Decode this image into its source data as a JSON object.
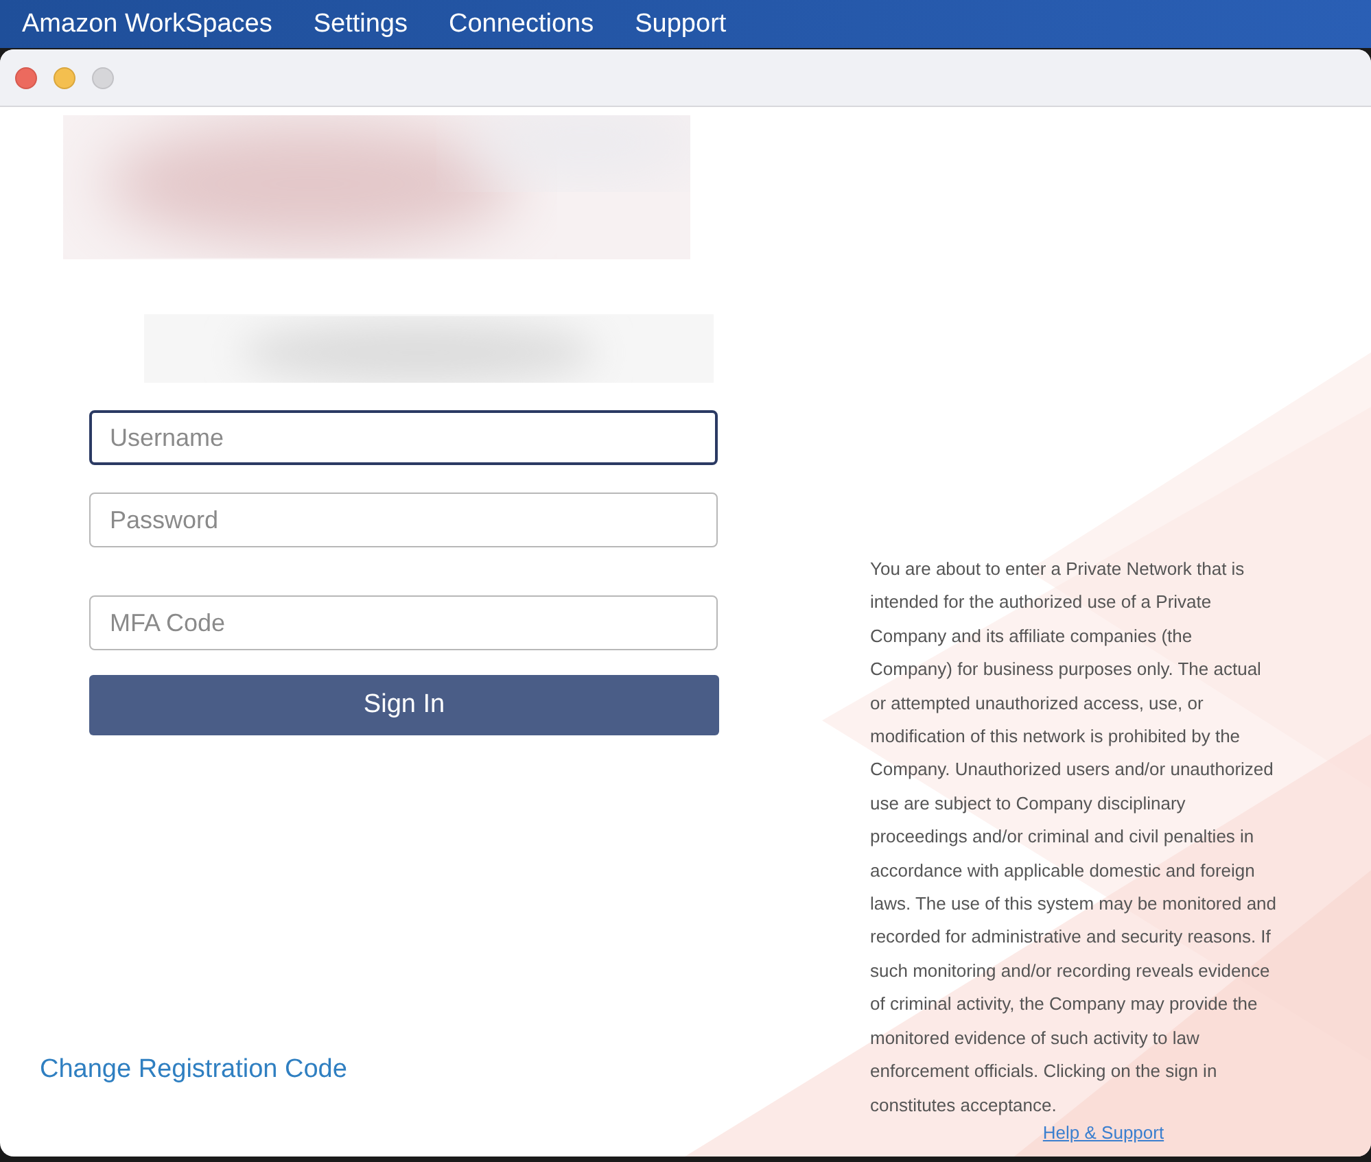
{
  "menu_bar": {
    "items": [
      "Amazon WorkSpaces",
      "Settings",
      "Connections",
      "Support"
    ]
  },
  "window": {
    "buttons": [
      {
        "kind": "close"
      },
      {
        "kind": "minimize"
      },
      {
        "kind": "zoom"
      }
    ]
  },
  "login": {
    "fields": [
      {
        "placeholder": "Username",
        "focused": true
      },
      {
        "placeholder": "Password",
        "focused": false
      },
      {
        "placeholder": "MFA Code",
        "focused": false
      }
    ],
    "sign_in_button": "Sign In",
    "change_registration_link": "Change Registration Code"
  },
  "notice": {
    "text": "You are about to enter a Private Network that is intended for the authorized use of a Private Company and its affiliate companies (the Company) for business purposes only. The actual or attempted unauthorized access, use, or modification of this network is prohibited by the Company. Unauthorized users and/or unauthorized use are subject to Company disciplinary proceedings and/or criminal and civil penalties in accordance with applicable domestic and foreign laws. The use of this system may be monitored and recorded for administrative and security reasons. If such monitoring and/or recording reveals evidence of criminal activity, the Company may provide the monitored evidence of such activity to law enforcement officials. Clicking on the sign in constitutes acceptance.",
    "help_link": "Help & Support"
  }
}
